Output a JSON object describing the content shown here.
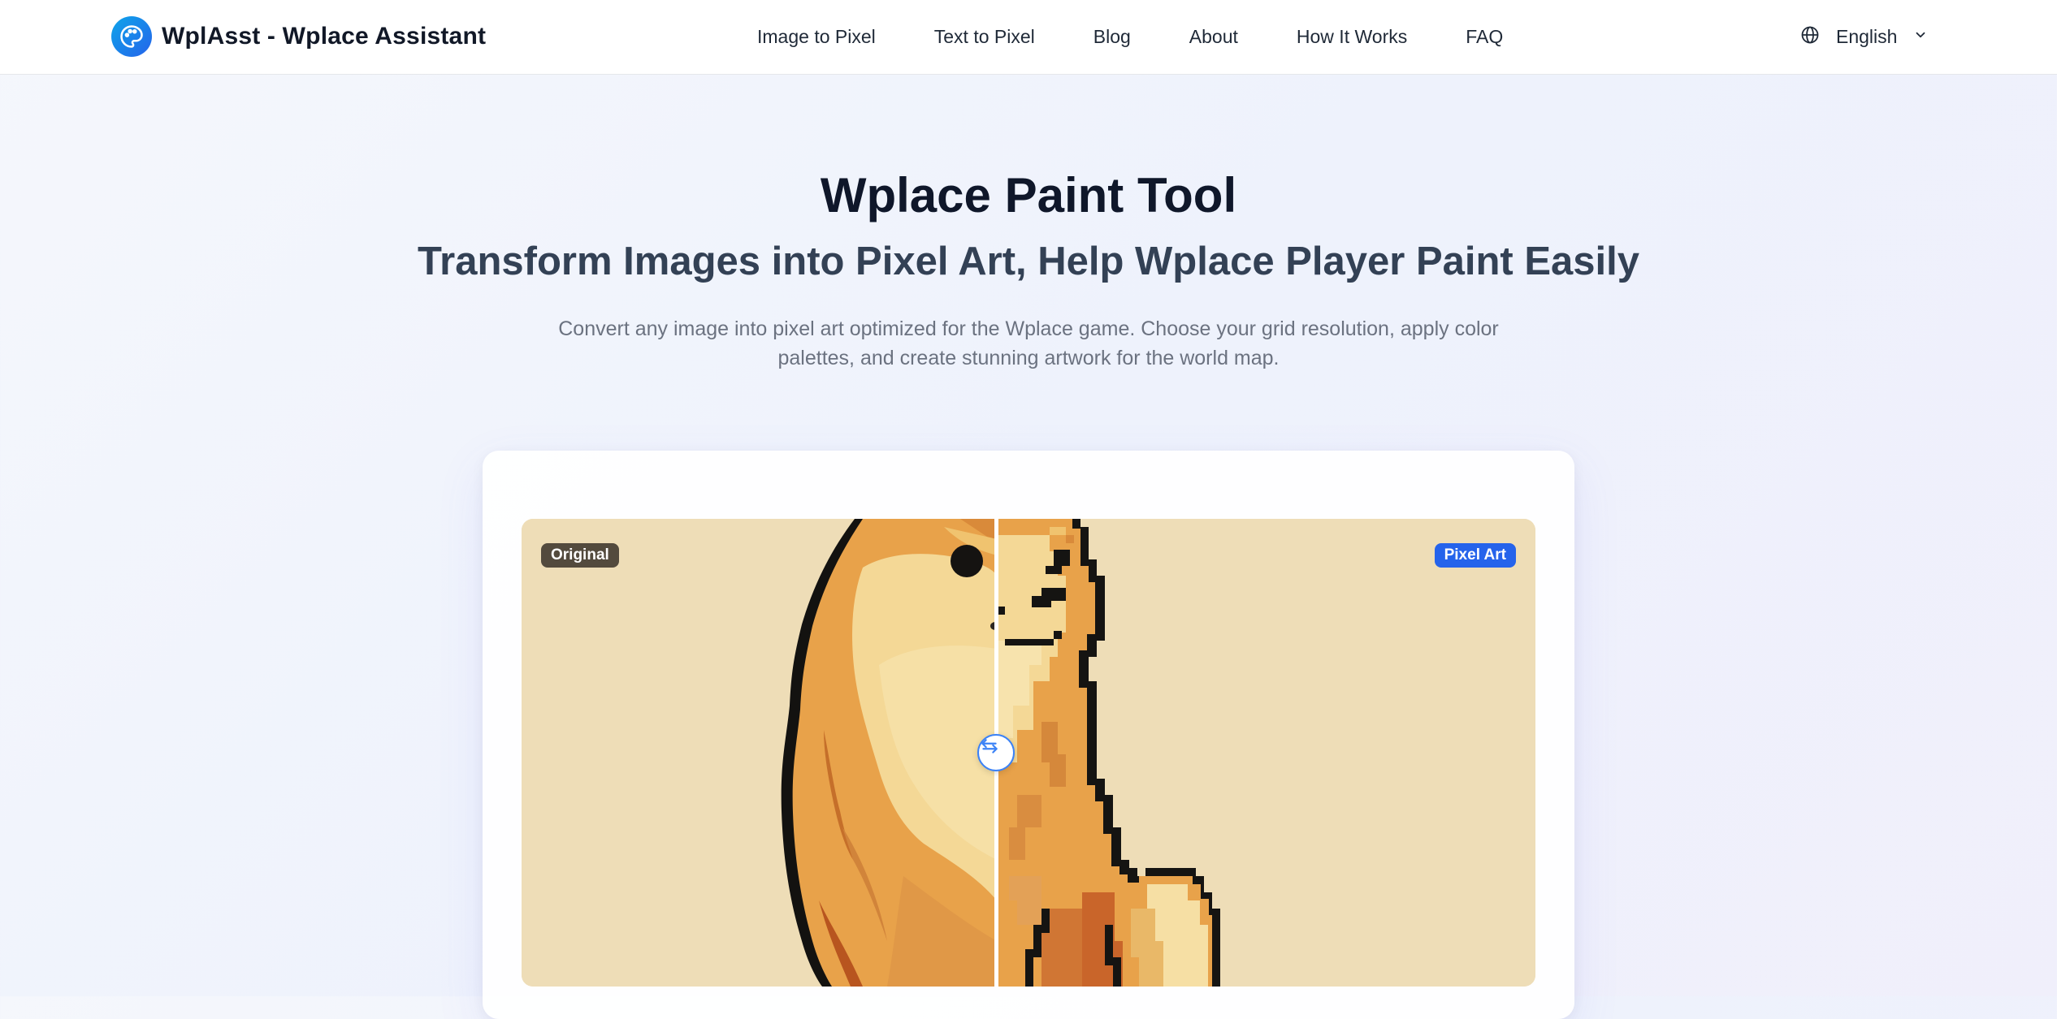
{
  "header": {
    "brand": "WplAsst - Wplace Assistant",
    "logo_icon": "palette-icon",
    "nav": [
      "Image to Pixel",
      "Text to Pixel",
      "Blog",
      "About",
      "How It Works",
      "FAQ"
    ],
    "language": {
      "label": "English",
      "icon": "globe-icon",
      "dropdown_icon": "chevron-down-icon"
    }
  },
  "hero": {
    "title": "Wplace Paint Tool",
    "subtitle": "Transform Images into Pixel Art, Help Wplace Player Paint Easily",
    "description": "Convert any image into pixel art optimized for the Wplace game. Choose your grid resolution, apply color palettes, and create stunning artwork for the world map."
  },
  "comparison": {
    "left_label": "Original",
    "right_label": "Pixel Art",
    "handle_icon": "swap-arrows-icon"
  },
  "colors": {
    "accent": "#2563eb",
    "canvas_background": "#eeddb7",
    "title": "#0f172a",
    "subtitle": "#334155"
  }
}
